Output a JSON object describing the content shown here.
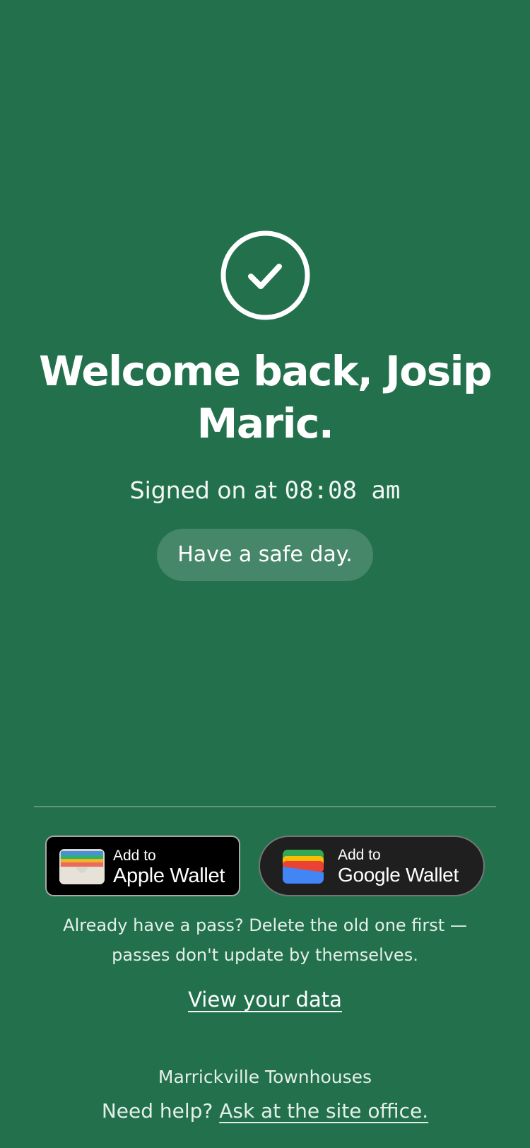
{
  "status": {
    "icon": "check-circle-icon"
  },
  "welcome": {
    "line1": "Welcome back, Josip",
    "line2": "Maric."
  },
  "signin": {
    "prefix": "Signed on at ",
    "time": "08:08 am"
  },
  "message": "Have a safe day.",
  "wallets": {
    "apple": {
      "small": "Add to",
      "big": "Apple Wallet",
      "icon": "apple-wallet-icon"
    },
    "google": {
      "small": "Add to",
      "big": "Google Wallet",
      "icon": "google-wallet-icon"
    }
  },
  "pass_note": {
    "line1": "Already have a pass? Delete the old one first —",
    "line2": "passes don't update by themselves."
  },
  "view_data_link": "View your data",
  "footer": {
    "site_name": "Marrickville Townhouses",
    "help_prefix": "Need help? ",
    "help_link": "Ask at the site office."
  },
  "colors": {
    "background": "#22714c",
    "text": "#ffffff",
    "pill": "rgba(255,255,255,0.16)"
  }
}
